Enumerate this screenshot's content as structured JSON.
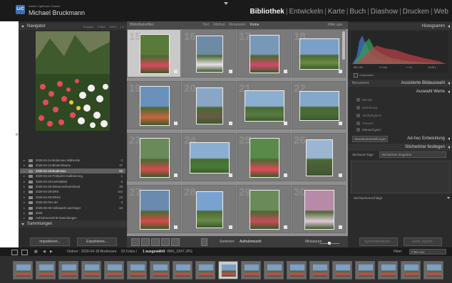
{
  "app": {
    "product_line": "Adobe Lightroom Classic",
    "user_name": "Michael Bruckmann",
    "logo_text": "LrC"
  },
  "modules": [
    "Bibliothek",
    "Entwickeln",
    "Karte",
    "Buch",
    "Diashow",
    "Drucken",
    "Web"
  ],
  "active_module": "Bibliothek",
  "navigator": {
    "title": "Navigator",
    "zoom_options": [
      "Einpass.",
      "Füllen",
      "100%",
      "1:4"
    ]
  },
  "folders": [
    {
      "name": "2026-04-14-Bodensee Blühende",
      "count": "2"
    },
    {
      "name": "2026-04-14-Blütenträume",
      "count": "17"
    },
    {
      "name": "2026-04-18-Bodensee",
      "count": "52",
      "selected": true
    },
    {
      "name": "2026-04-22-Frühjahrs-Kalibrierung",
      "count": "1"
    },
    {
      "name": "2026-04-25-Herbstblatt",
      "count": "6"
    },
    {
      "name": "2026-04-26-Wiesenschaumkraut",
      "count": "28"
    },
    {
      "name": "2026-04-29-DRK",
      "count": "144"
    },
    {
      "name": "2026-04-29-DRK2",
      "count": "23"
    },
    {
      "name": "2026-05-06-L4H",
      "count": "3"
    },
    {
      "name": "2026-05-06-Volkspark-Laichinger",
      "count": "44"
    },
    {
      "name": "2026",
      "count": ""
    },
    {
      "name": "Aufnahmeschritt-Sammlungen",
      "count": ""
    }
  ],
  "left_panel": {
    "publish_label": "Antivirus",
    "collections_label": "Sammlungen",
    "import_button": "Importieren...",
    "export_button": "Exportieren..."
  },
  "filter_bar": {
    "label": "Bibliotheksfilter :",
    "options": [
      "Text",
      "Attribut",
      "Metadaten",
      "Keine"
    ],
    "active_option": "Keine",
    "filter_status": "Filter aus"
  },
  "grid": {
    "cells": [
      {
        "num": "15",
        "selected": true
      },
      {
        "num": "16"
      },
      {
        "num": "17"
      },
      {
        "num": "18"
      },
      {
        "num": "19"
      },
      {
        "num": "20"
      },
      {
        "num": "21"
      },
      {
        "num": "22"
      },
      {
        "num": "23"
      },
      {
        "num": "24"
      },
      {
        "num": "25"
      },
      {
        "num": "26"
      },
      {
        "num": "27"
      },
      {
        "num": "28"
      },
      {
        "num": "29"
      },
      {
        "num": "30"
      }
    ]
  },
  "toolbar": {
    "sort_label": "Sortieren:",
    "sort_value": "Aufnahmezeit",
    "thumbnails_label": "Miniaturen"
  },
  "right_panel": {
    "histogram_title": "Histogramm",
    "histogram_values": [
      "ISO 100",
      "17 mm",
      "f / 14",
      "1/125 s"
    ],
    "original_photo_label": "Originalfoto",
    "quick_develop_preset_label": "Benutzerd.",
    "quick_develop_title": "Assistierte Bildauswahl",
    "auto_values": "Auswahl Werte",
    "dim_items": [
      "Blende",
      "Belichtung",
      "Weißabgleich",
      "Tonwert"
    ],
    "manual_label": "Manuell ganz",
    "adhoc_preset": "Standardeinstellungen",
    "adhoc_title": "Ad-hoc Entwicklung",
    "keywording_title": "Stichwörter festlegen",
    "keyword_tags_label": "Stichwort-Tags",
    "keyword_input": "Stichwörter eingeben",
    "suggestions_label": "Stichwortvorschläge",
    "sync_button": "Synchronisieren...",
    "sync_settings_button": "Einst. synchr."
  },
  "filmstrip_bar": {
    "page_numbers": [
      "1",
      "2"
    ],
    "folder_text": "Ordner : 2026-04-18-Bodensee",
    "photo_count": "52 Fotos /",
    "selected_text": "1 ausgewählt",
    "filename": "/IMG_0347.JPG",
    "filter_label": "Filter:",
    "filter_value": "Filter aus"
  },
  "colors": {
    "accent_highlight": "#c9c9c9",
    "panel_bg": "#2b2b2b",
    "grid_bg": "#8f8f8f",
    "topbar_bg": "#1a1a1a"
  }
}
